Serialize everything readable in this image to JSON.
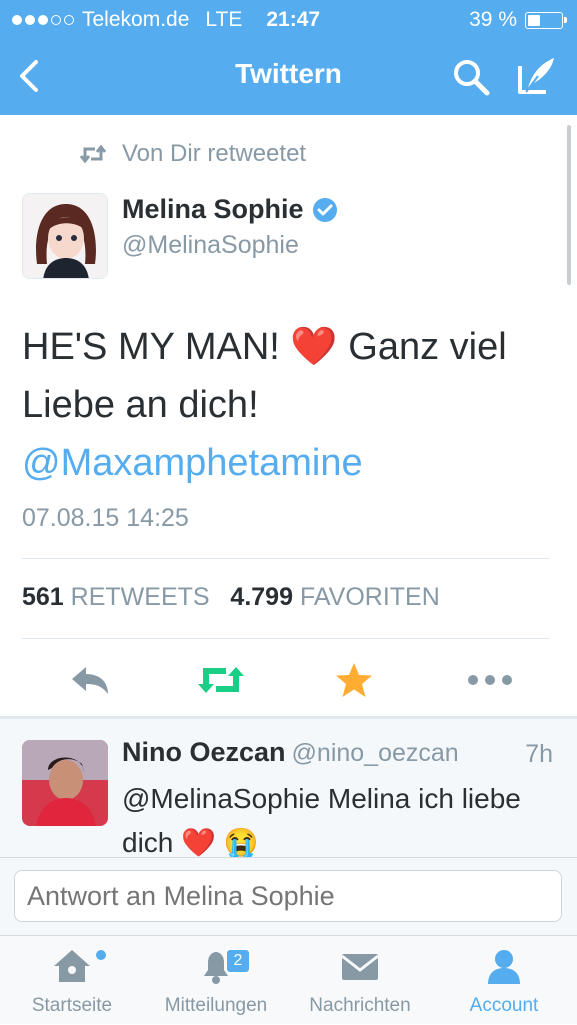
{
  "status_bar": {
    "carrier": "Telekom.de",
    "network": "LTE",
    "time": "21:47",
    "battery_text": "39 %",
    "battery_level": 0.39
  },
  "nav": {
    "title": "Twittern"
  },
  "tweet": {
    "retweet_note": "Von Dir retweetet",
    "author_name": "Melina Sophie",
    "author_handle": "@MelinaSophie",
    "text_part1": "HE'S MY MAN!",
    "text_emoji": "❤️",
    "text_part2": "Ganz viel Liebe an dich!",
    "mention": "@Maxamphetamine",
    "datetime": "07.08.15 14:25",
    "retweet_count": "561",
    "retweet_label": "RETWEETS",
    "favorite_count": "4.799",
    "favorite_label": "FAVORITEN"
  },
  "reply": {
    "author_name": "Nino Oezcan",
    "author_handle": "@nino_oezcan",
    "time_ago": "7h",
    "text": "@MelinaSophie Melina ich liebe dich",
    "emoji": "❤️ 😭"
  },
  "composer": {
    "placeholder": "Antwort an Melina Sophie"
  },
  "tabs": {
    "home": "Startseite",
    "notifications": "Mitteilungen",
    "notifications_badge": "2",
    "messages": "Nachrichten",
    "account": "Account"
  },
  "colors": {
    "brand": "#55acee",
    "retweet_green": "#19cf86",
    "favorite_orange": "#ffac33",
    "muted": "#8899a6"
  }
}
